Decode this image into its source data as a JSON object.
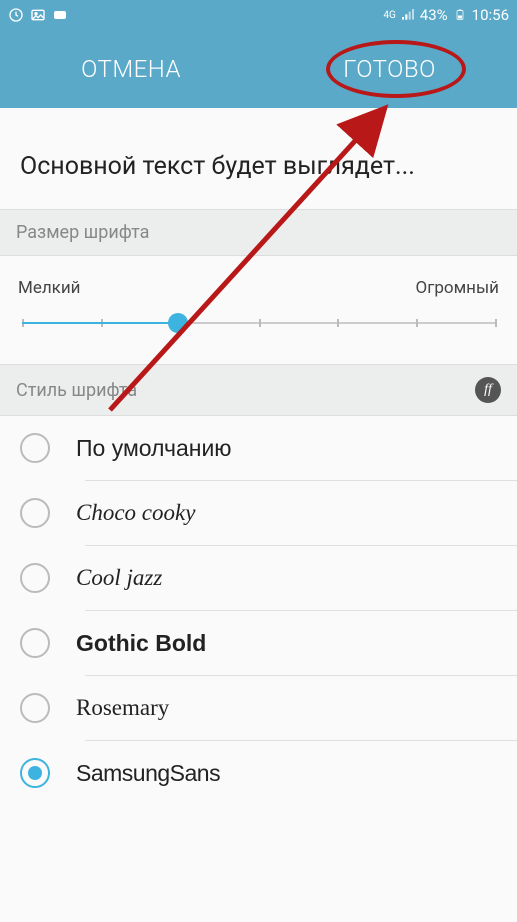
{
  "status_bar": {
    "network_indicator": "4G",
    "battery_percent": "43%",
    "time": "10:56"
  },
  "header": {
    "cancel_label": "ОТМЕНА",
    "done_label": "ГОТОВО"
  },
  "preview": {
    "text": "Основной текст будет выглядет..."
  },
  "font_size": {
    "section_title": "Размер шрифта",
    "min_label": "Мелкий",
    "max_label": "Огромный",
    "value_percent": 33
  },
  "font_style": {
    "section_title": "Стиль шрифта",
    "badge_text": "ff",
    "options": [
      {
        "label": "По умолчанию",
        "selected": false,
        "class": "f-default"
      },
      {
        "label": "Choco cooky",
        "selected": false,
        "class": "f-choco"
      },
      {
        "label": "Cool jazz",
        "selected": false,
        "class": "f-cool"
      },
      {
        "label": "Gothic Bold",
        "selected": false,
        "class": "f-gothic"
      },
      {
        "label": "Rosemary",
        "selected": false,
        "class": "f-rosemary"
      },
      {
        "label": "SamsungSans",
        "selected": true,
        "class": "f-samsung"
      }
    ]
  },
  "annotation": {
    "circle_target": "done-button"
  }
}
